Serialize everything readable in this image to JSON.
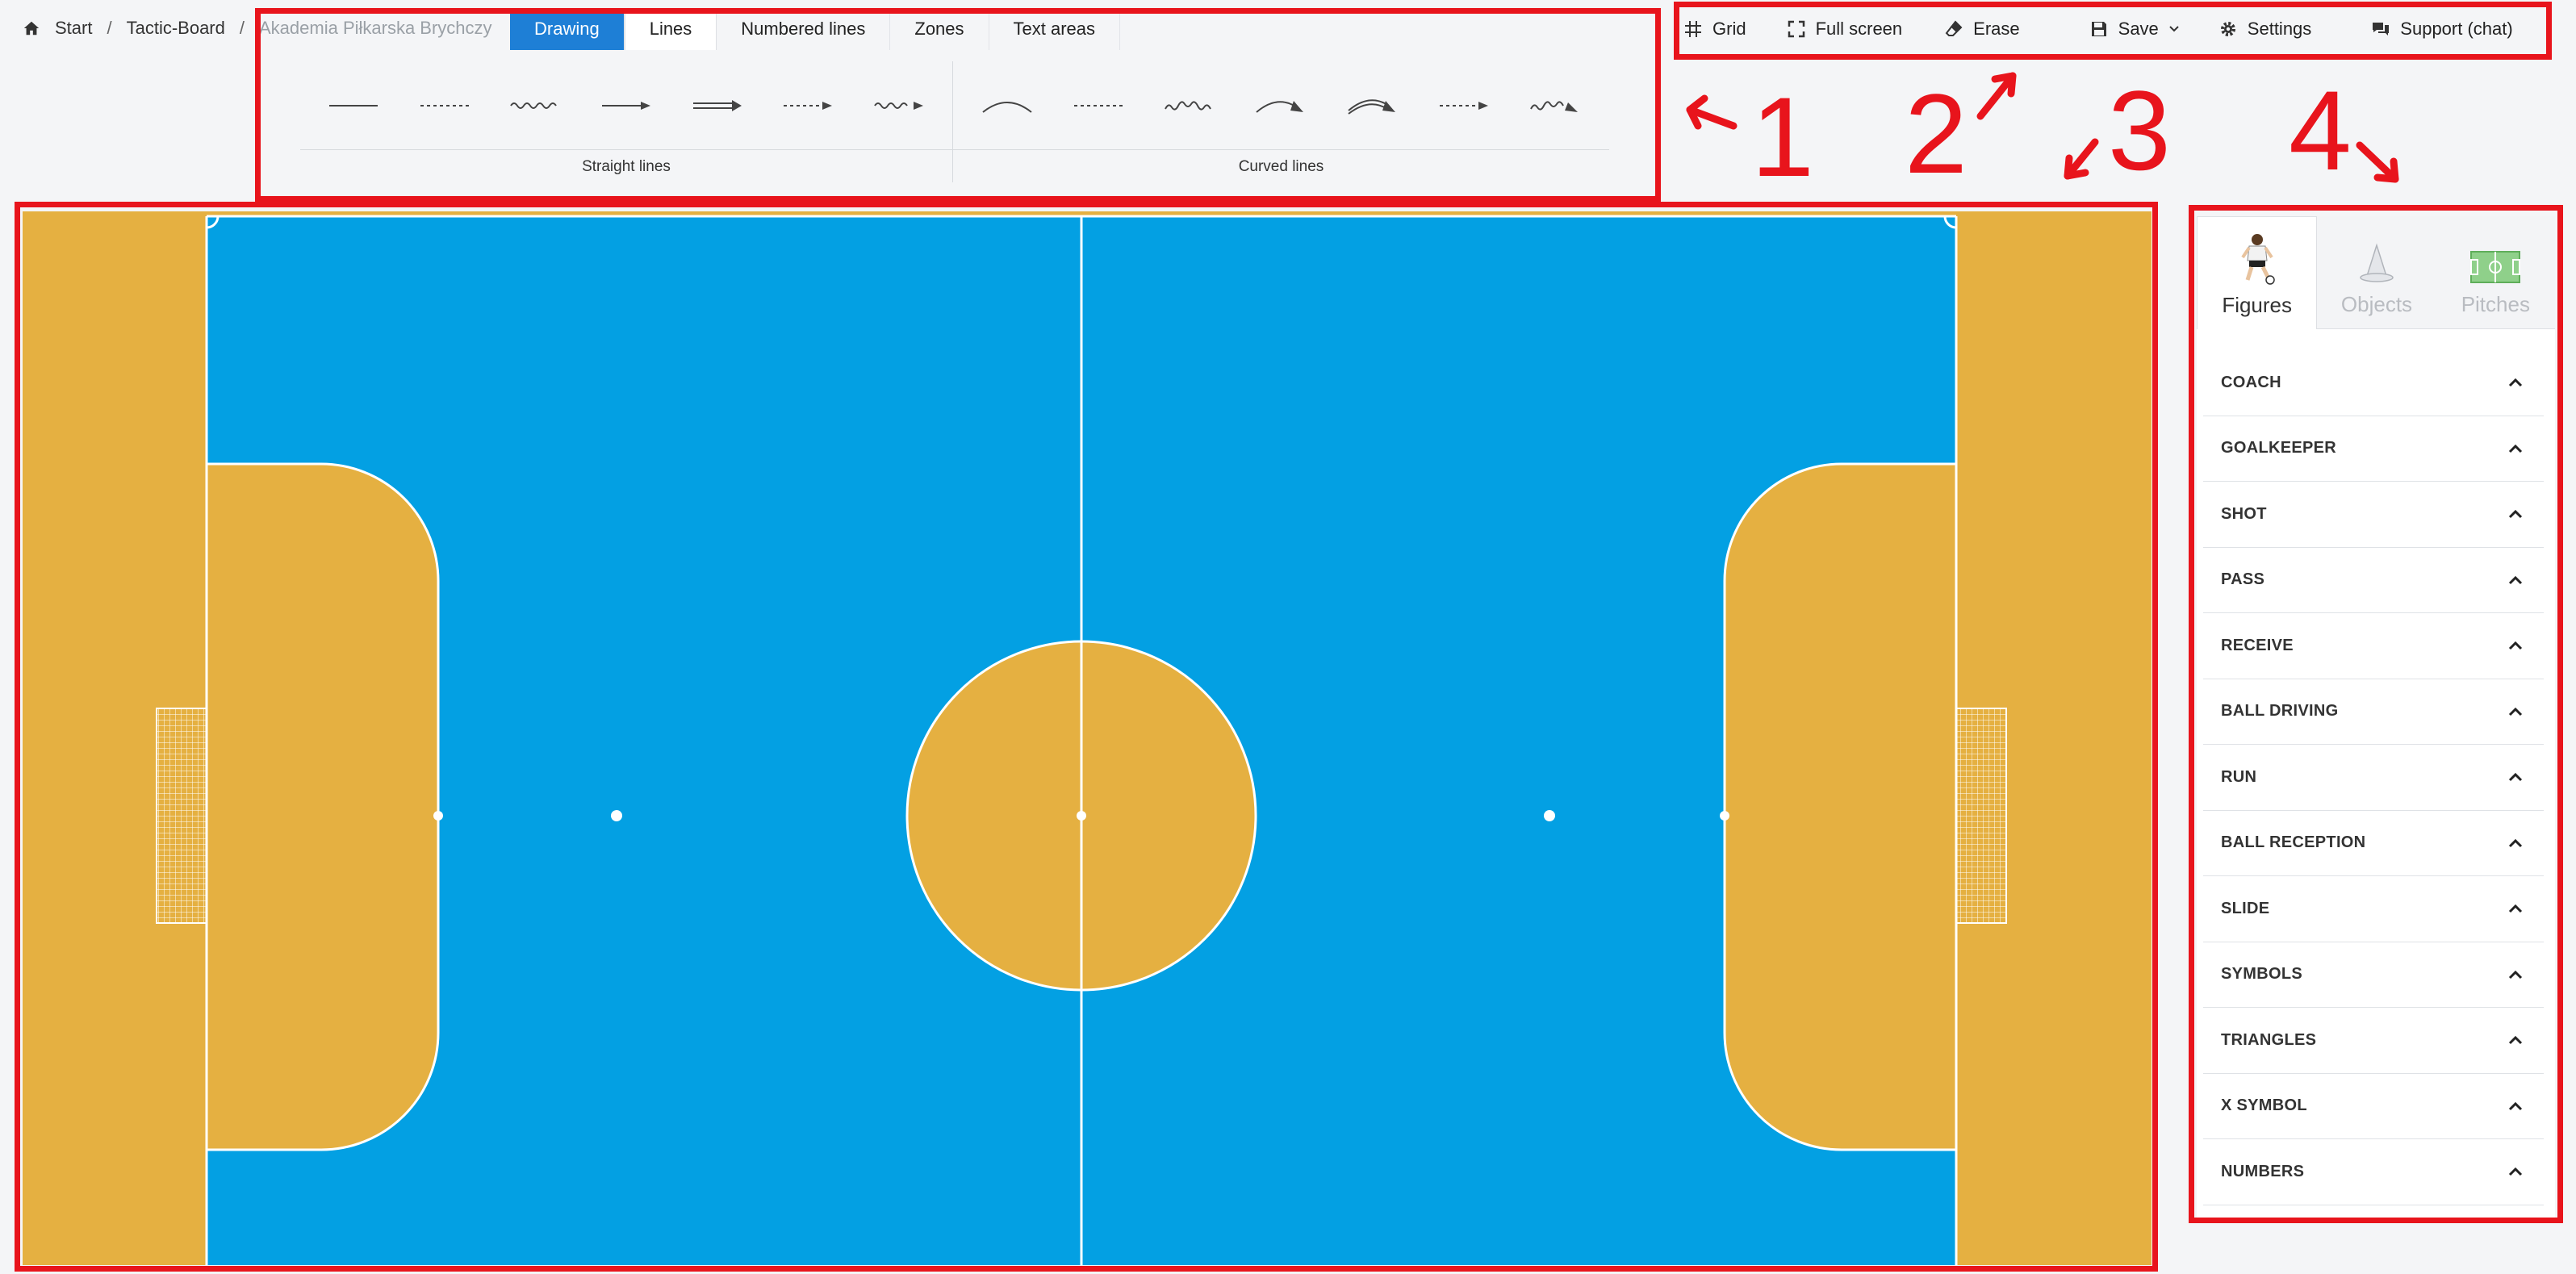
{
  "breadcrumb": {
    "items": [
      "Start",
      "Tactic-Board",
      "Akademia Piłkarska Brychczy"
    ],
    "separator": "/"
  },
  "tabs": [
    {
      "label": "Drawing",
      "state": "active"
    },
    {
      "label": "Lines",
      "state": "selected"
    },
    {
      "label": "Numbered lines",
      "state": "normal"
    },
    {
      "label": "Zones",
      "state": "normal"
    },
    {
      "label": "Text areas",
      "state": "normal"
    }
  ],
  "palette": {
    "straight_label": "Straight lines",
    "curved_label": "Curved lines"
  },
  "toolbar": {
    "grid": "Grid",
    "fullscreen": "Full screen",
    "erase": "Erase",
    "save": "Save",
    "settings": "Settings",
    "support": "Support (chat)"
  },
  "annotations": [
    "1",
    "2",
    "3",
    "4"
  ],
  "panel": {
    "tabs": [
      {
        "label": "Figures",
        "icon": "player-figure-icon",
        "active": true
      },
      {
        "label": "Objects",
        "icon": "cone-icon",
        "active": false
      },
      {
        "label": "Pitches",
        "icon": "pitch-icon",
        "active": false
      }
    ],
    "categories": [
      "COACH",
      "GOALKEEPER",
      "SHOT",
      "PASS",
      "RECEIVE",
      "BALL DRIVING",
      "RUN",
      "BALL RECEPTION",
      "SLIDE",
      "SYMBOLS",
      "TRIANGLES",
      "X SYMBOL",
      "NUMBERS"
    ]
  },
  "colors": {
    "accent": "#1e7fd6",
    "pitch_blue": "#03a0e3",
    "pitch_orange": "#e5b041",
    "annotation_red": "#e8141c"
  }
}
